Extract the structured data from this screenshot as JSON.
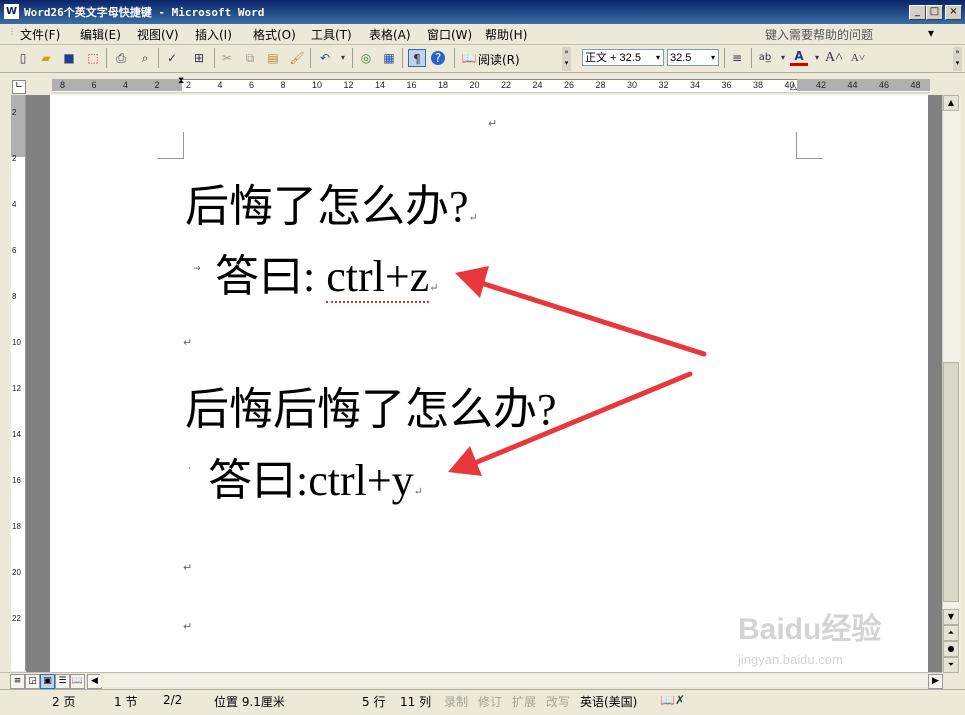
{
  "window": {
    "title": "Word26个英文字母快捷键 - Microsoft Word",
    "icon_letter": "W"
  },
  "menu": [
    "文件(F)",
    "编辑(E)",
    "视图(V)",
    "插入(I)",
    "格式(O)",
    "工具(T)",
    "表格(A)",
    "窗口(W)",
    "帮助(H)"
  ],
  "help_box": {
    "placeholder": "键入需要帮助的问题"
  },
  "toolbar": {
    "read_label": "阅读(R)",
    "style": "正文 + 32.5",
    "size": "32.5",
    "font_color": "#d60000"
  },
  "ruler": {
    "h_numbers": [
      "8",
      "6",
      "4",
      "2",
      "2",
      "4",
      "6",
      "8",
      "10",
      "12",
      "14",
      "16",
      "18",
      "20",
      "22",
      "24",
      "26",
      "28",
      "30",
      "32",
      "34",
      "36",
      "38",
      "40",
      "42",
      "44",
      "46",
      "48"
    ],
    "v_numbers": [
      "2",
      "2",
      "4",
      "6",
      "8",
      "10",
      "12",
      "14",
      "16",
      "18",
      "20",
      "22"
    ]
  },
  "document": {
    "lines": [
      {
        "text": "后悔了怎么办?"
      },
      {
        "prefix": "答曰: ",
        "squiggle": "ctrl+z"
      },
      {
        "text": "后悔后悔了怎么办?"
      },
      {
        "prefix": "答曰:",
        "squiggle": "ctrl+y"
      }
    ],
    "para_mark": "↵",
    "arrow_color": "#e8383b"
  },
  "status": {
    "page": "2 页",
    "section": "1 节",
    "page_of": "2/2",
    "position": "位置 9.1厘米",
    "line": "5 行",
    "column": "11 列",
    "rec": "录制",
    "trk": "修订",
    "ext": "扩展",
    "ovr": "改写",
    "lang": "英语(美国)"
  },
  "watermark": {
    "brand": "Baidu经验",
    "url": "jingyan.baidu.com"
  }
}
